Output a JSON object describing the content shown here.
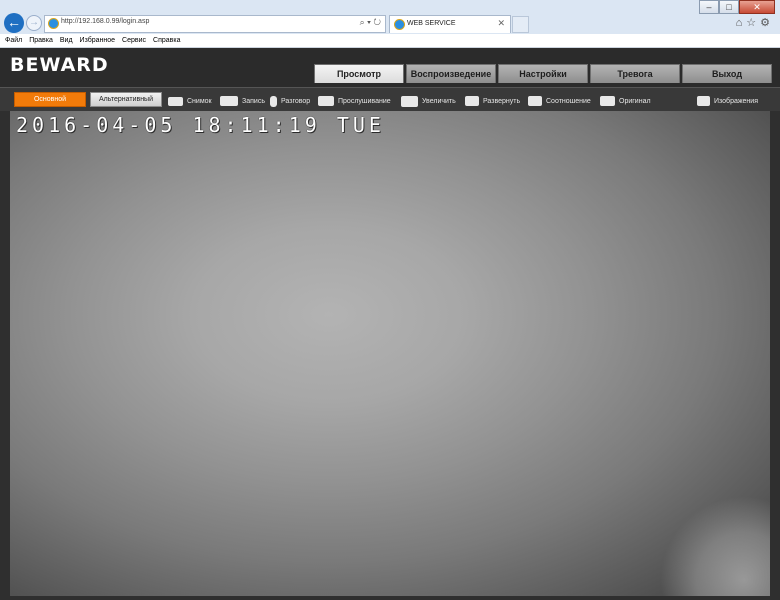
{
  "browser": {
    "url": "http://192.168.0.99/login.asp",
    "tab_title": "WEB SERVICE",
    "menu": [
      "Файл",
      "Правка",
      "Вид",
      "Избранное",
      "Сервис",
      "Справка"
    ]
  },
  "app": {
    "logo": "BEWARD",
    "tabs": [
      {
        "label": "Просмотр",
        "active": true
      },
      {
        "label": "Воспроизведение",
        "active": false
      },
      {
        "label": "Настройки",
        "active": false
      },
      {
        "label": "Тревога",
        "active": false
      },
      {
        "label": "Выход",
        "active": false
      }
    ]
  },
  "toolbar": {
    "stream_main": "Основной",
    "stream_alt": "Альтернативный",
    "snapshot": "Снимок",
    "record": "Запись",
    "talk": "Разговор",
    "listen": "Прослушивание",
    "zoom": "Увеличить",
    "expand": "Развернуть",
    "ratio": "Соотношение",
    "original": "Оригинал",
    "images": "Изображения"
  },
  "video": {
    "osd_timestamp": "2016-04-05 18:11:19 TUE"
  },
  "colors": {
    "accent": "#f27b0a",
    "page_bg": "#2f2f2f"
  }
}
